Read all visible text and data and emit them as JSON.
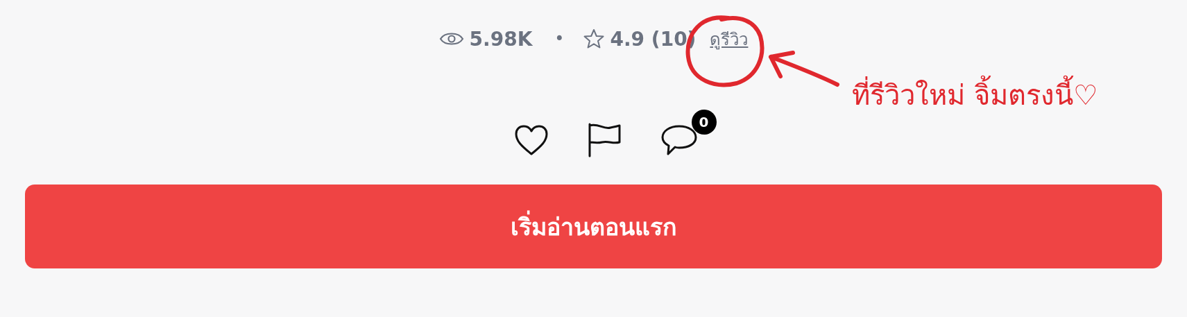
{
  "stats": {
    "views": "5.98K",
    "separator": "•",
    "rating": "4.9 (10)",
    "reviews_link": "ดูรีวิว"
  },
  "actions": [
    {
      "kind": "like"
    },
    {
      "kind": "report"
    },
    {
      "kind": "comment",
      "count": "0"
    }
  ],
  "start_button": "เริ่มอ่านตอนแรก",
  "annotation": {
    "text": "ที่รีวิวใหม่ จิ้มตรงนี้♡"
  }
}
